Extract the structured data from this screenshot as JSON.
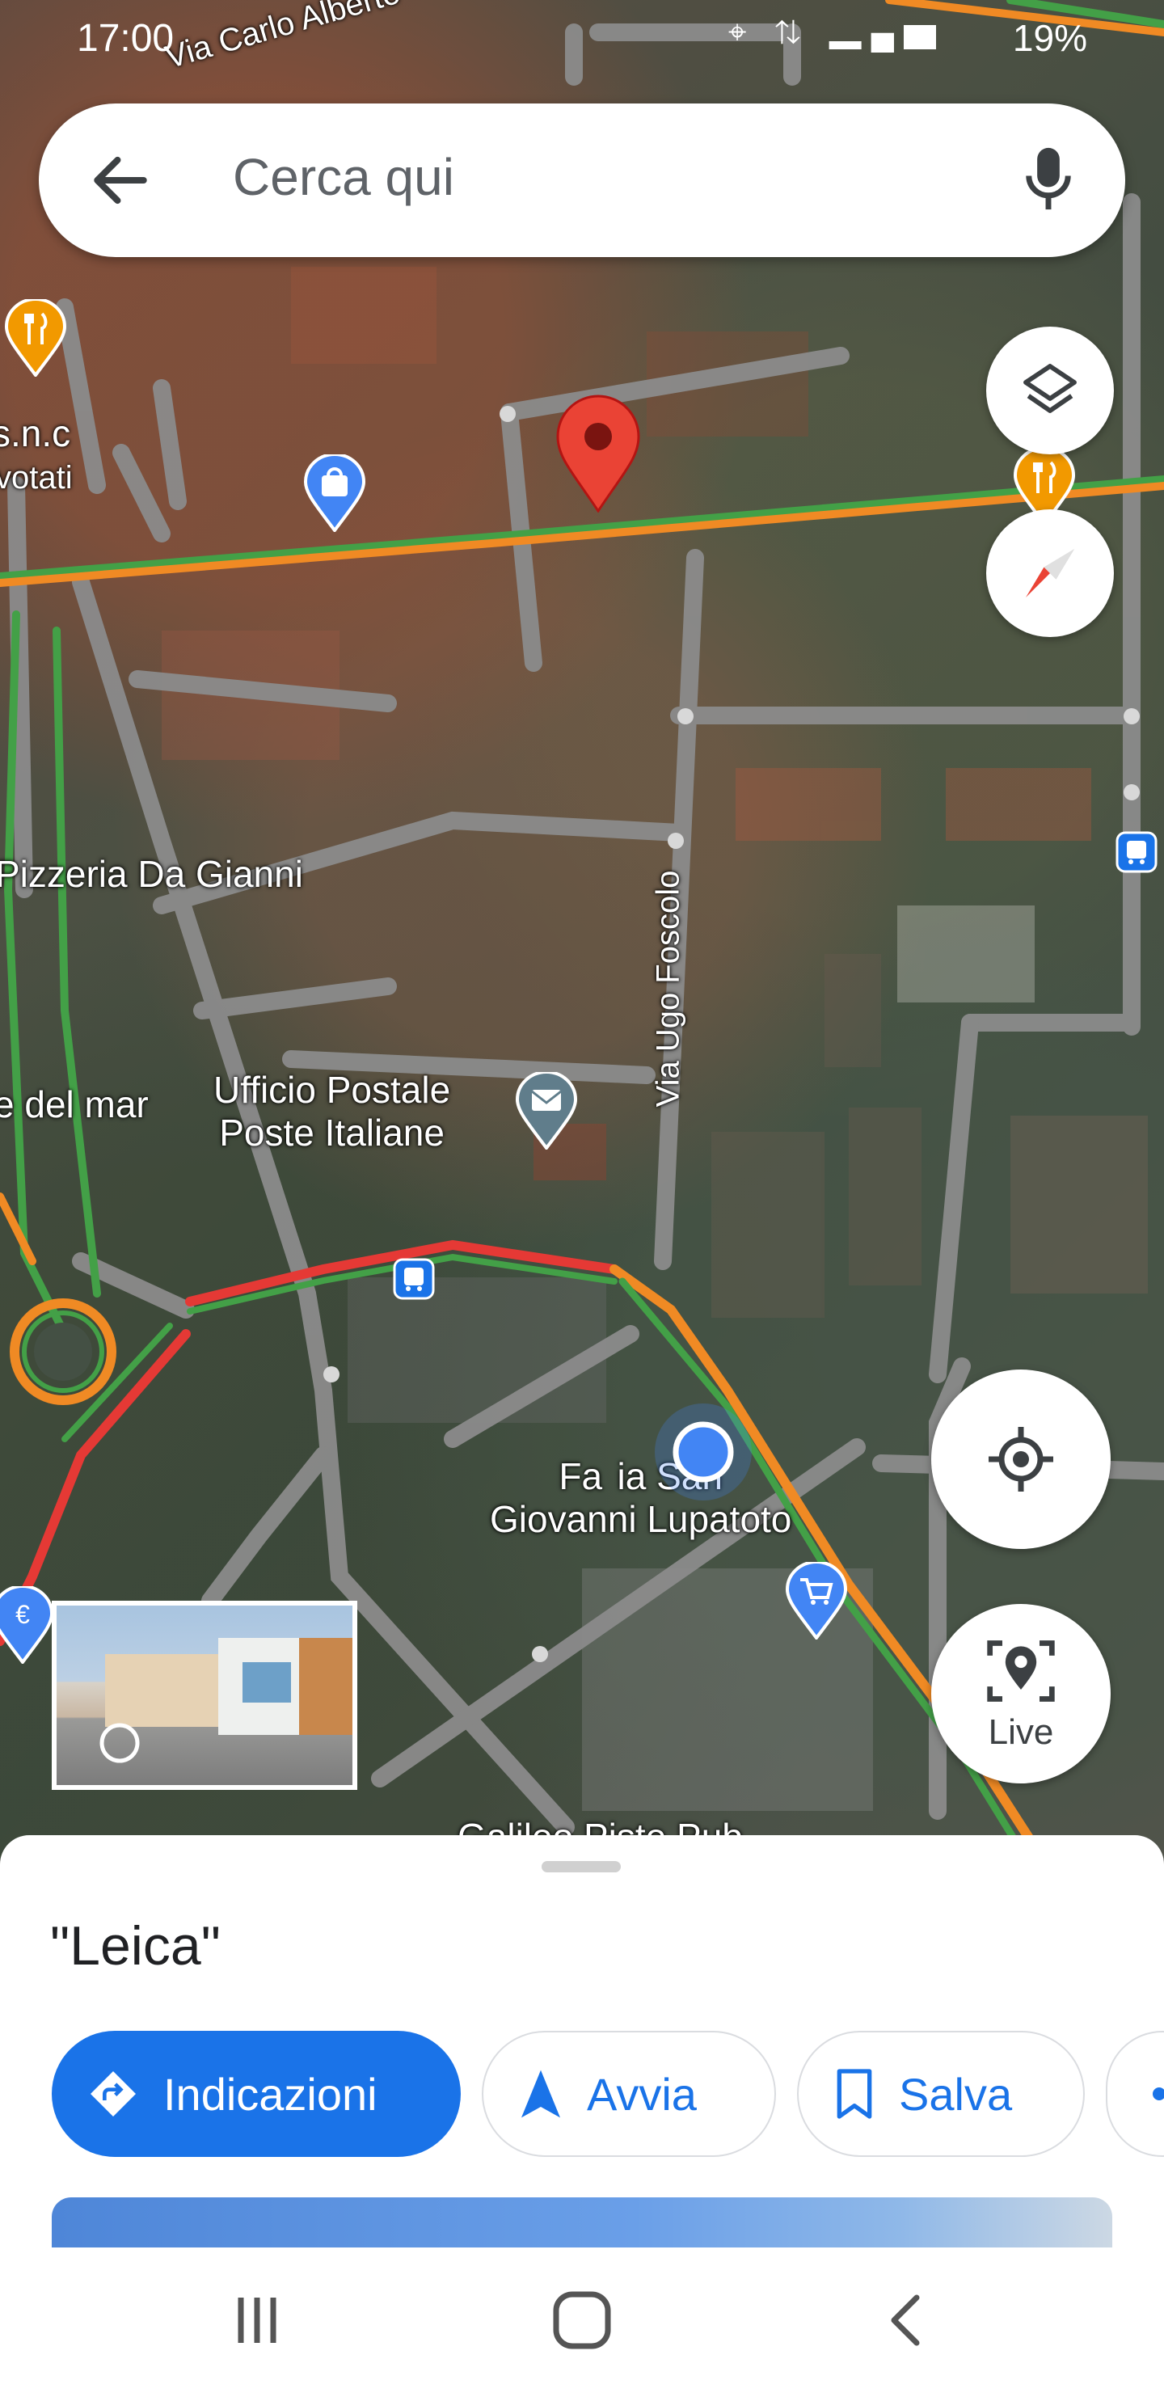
{
  "status_bar": {
    "time": "17:00",
    "icons": "⌖ ⇅ ▂▄▆",
    "battery": "19%"
  },
  "search": {
    "placeholder": "Cerca qui"
  },
  "map_labels": {
    "street_top": "Via Carlo Alberto",
    "snc": "s.n.c",
    "votati": "votati",
    "pizzeria": "Pizzeria Da Gianni",
    "del_mar": "e del mar",
    "ufficio": "Ufficio Postale\nPoste Italiane",
    "via_foscolo": "Via Ugo Foscolo",
    "farmacia": "Fa  ia San\nGiovanni Lupatoto",
    "galileo": "Galileo Piste Pub"
  },
  "live_button": {
    "label": "Live"
  },
  "place": {
    "title": "\"Leica\""
  },
  "actions": [
    {
      "label": "Indicazioni"
    },
    {
      "label": "Avvia"
    },
    {
      "label": "Salva"
    }
  ],
  "colors": {
    "accent": "#1a73e8",
    "pin": "#ea4335",
    "traffic_red": "#e53935",
    "traffic_green": "#43a047",
    "traffic_orange": "#f08a24"
  }
}
